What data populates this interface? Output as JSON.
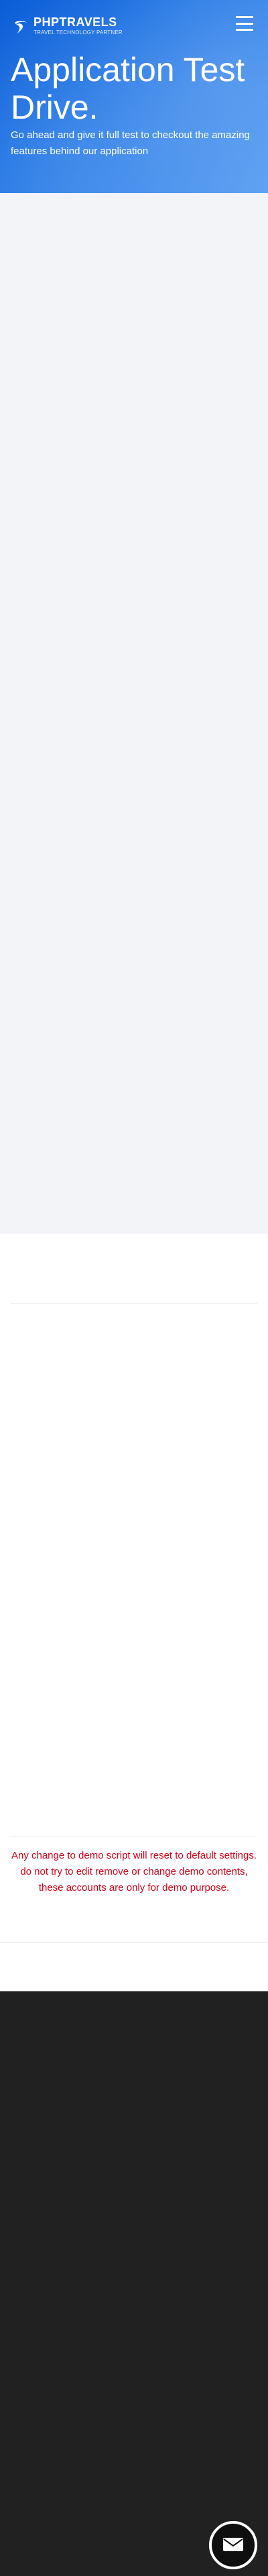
{
  "header": {
    "brand": "PHPTRAVELS",
    "tagline": "TRAVEL TECHNOLOGY PARTNER",
    "logo_icon": "brand-logo-icon",
    "menu_icon": "hamburger-menu-icon"
  },
  "hero": {
    "title": "Application Test Drive.",
    "subtitle": "Go ahead and give it full test to checkout the amazing features behind our application"
  },
  "notice": {
    "text": "Any change to demo script will reset to default settings. do not try to edit remove or change demo contents, these accounts are only for demo purpose."
  },
  "contact": {
    "icon": "mail-icon"
  },
  "colors": {
    "hero_primary": "#0b5dd7",
    "hero_secondary": "#5ea2f3",
    "panel_bg": "#f3f4f8",
    "notice_text": "#d0021b",
    "footer_bg": "#212121",
    "fab_bg": "#0f0f0f"
  }
}
